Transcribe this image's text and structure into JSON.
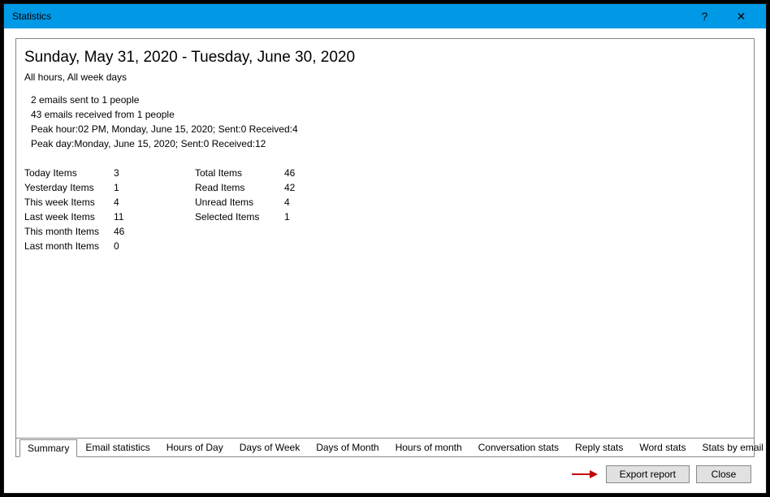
{
  "window": {
    "title": "Statistics",
    "help": "?",
    "close": "✕"
  },
  "heading": "Sunday, May 31, 2020 - Tuesday, June 30, 2020",
  "subheading": "All hours, All week days",
  "summary": {
    "line1": "2 emails sent to 1 people",
    "line2": "43 emails received from 1 people",
    "line3": "Peak hour:02 PM, Monday, June 15, 2020; Sent:0 Received:4",
    "line4": "Peak day:Monday, June 15, 2020; Sent:0 Received:12"
  },
  "stats_left": {
    "l1": "Today Items",
    "v1": "3",
    "l2": "Yesterday Items",
    "v2": "1",
    "l3": "This week Items",
    "v3": "4",
    "l4": "Last week Items",
    "v4": "11",
    "l5": "This month Items",
    "v5": "46",
    "l6": "Last month Items",
    "v6": "0"
  },
  "stats_right": {
    "l1": "Total Items",
    "v1": "46",
    "l2": "Read Items",
    "v2": "42",
    "l3": "Unread Items",
    "v3": "4",
    "l4": "Selected Items",
    "v4": "1"
  },
  "tabs": {
    "t1": "Summary",
    "t2": "Email statistics",
    "t3": "Hours of Day",
    "t4": "Days of Week",
    "t5": "Days of Month",
    "t6": "Hours of month",
    "t7": "Conversation stats",
    "t8": "Reply stats",
    "t9": "Word stats",
    "t10": "Stats by email address"
  },
  "footer": {
    "export": "Export report",
    "close": "Close"
  },
  "colors": {
    "titlebar": "#0099e5",
    "arrow": "#C00000"
  }
}
